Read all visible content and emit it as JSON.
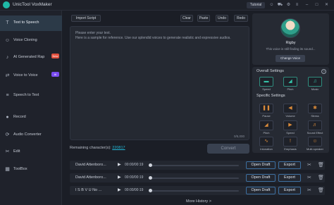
{
  "app": {
    "title": "UnicTool VoxMaker"
  },
  "titlebar": {
    "tutorial_label": "Tutorial"
  },
  "sidebar": {
    "items": [
      {
        "label": "Text to Speech",
        "icon": "T"
      },
      {
        "label": "Voice Cloning",
        "icon": "☺"
      },
      {
        "label": "AI Generated Rap",
        "icon": "♪",
        "badge": "New"
      },
      {
        "label": "Voice to Voice",
        "icon": "⇄",
        "badge": "AI"
      },
      {
        "label": "Speech to Text",
        "icon": "≡"
      },
      {
        "label": "Record",
        "icon": "●"
      },
      {
        "label": "Audio Converter",
        "icon": "⟳"
      },
      {
        "label": "Edit",
        "icon": "✂"
      },
      {
        "label": "ToolBox",
        "icon": "▦"
      }
    ]
  },
  "toolbar": {
    "import_label": "Import Script",
    "clear_label": "Clear",
    "paste_label": "Paste",
    "undo_label": "Undo",
    "redo_label": "Redo"
  },
  "editor": {
    "placeholder": "Please enter your text.",
    "sample": "Here is a sample for reference. Use our splendid voices to generate realistic and expressive audios.",
    "counter": "0/5,000"
  },
  "remaining": {
    "label": "Remaining character(s):",
    "value": "220817"
  },
  "convert_label": "Convert",
  "history": {
    "rows": [
      {
        "name": "David Attenboro...",
        "time": "00:00/00:19",
        "open": "Open Draft",
        "export": "Export"
      },
      {
        "name": "David Attenboro...",
        "time": "00:00/00:19",
        "open": "Open Draft",
        "export": "Export"
      },
      {
        "name": "I S B V U No ...",
        "time": "00:00/00:19",
        "open": "Open Draft",
        "export": "Export"
      }
    ],
    "more_label": "More History >"
  },
  "voice": {
    "name": "Rigby",
    "desc": "This voice is still finding its sound...",
    "change_label": "Change Voice"
  },
  "settings": {
    "overall_title": "Overall Settings",
    "overall": [
      {
        "label": "Speed",
        "glyph": "▬"
      },
      {
        "label": "Pitch",
        "glyph": "◢"
      },
      {
        "label": "Music",
        "glyph": "♫"
      }
    ],
    "specific_title": "Specific Settings",
    "specific": [
      {
        "label": "Pause",
        "glyph": "❚❚"
      },
      {
        "label": "Volume",
        "glyph": "◀"
      },
      {
        "label": "Stress",
        "glyph": "✱"
      },
      {
        "label": "Pitch",
        "glyph": "◢"
      },
      {
        "label": "Speed",
        "glyph": "▶"
      },
      {
        "label": "Sound Effect",
        "glyph": "♬"
      },
      {
        "label": "Intonation",
        "glyph": "∿"
      },
      {
        "label": "Emphasis",
        "glyph": "!"
      },
      {
        "label": "Multi-speaker",
        "glyph": "☺"
      }
    ]
  }
}
